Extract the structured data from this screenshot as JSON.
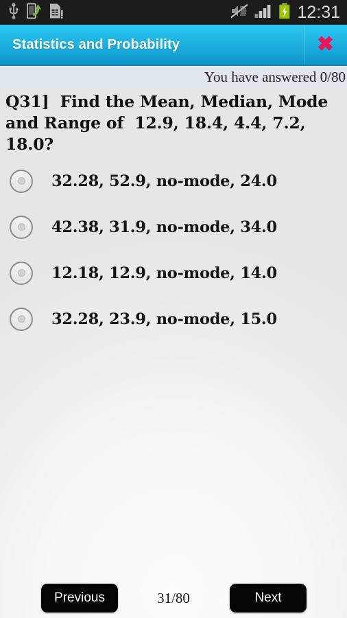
{
  "statusbar": {
    "time": "12:31",
    "icons_left": [
      "usb-icon",
      "phone-transfer-icon",
      "sim-card-icon"
    ],
    "icons_right": [
      "mute-icon",
      "signal-bars-icon",
      "battery-charging-icon"
    ]
  },
  "header": {
    "title": "Statistics and Probability",
    "close_label": "✖",
    "background_color": "#1fb4e3",
    "close_color": "#e8175d"
  },
  "progress": {
    "answered_text": "You have answered 0/80"
  },
  "question": {
    "text": "Q31]  Find the Mean, Median, Mode and Range of  12.9, 18.4, 4.4, 7.2, 18.0?"
  },
  "options": [
    {
      "label": "32.28, 52.9, no-mode, 24.0",
      "selected": false
    },
    {
      "label": "42.38, 31.9, no-mode, 34.0",
      "selected": false
    },
    {
      "label": "12.18, 12.9, no-mode, 14.0",
      "selected": false
    },
    {
      "label": "32.28, 23.9, no-mode, 15.0",
      "selected": false
    }
  ],
  "footer": {
    "previous_label": "Previous",
    "next_label": "Next",
    "page_counter": "31/80"
  }
}
